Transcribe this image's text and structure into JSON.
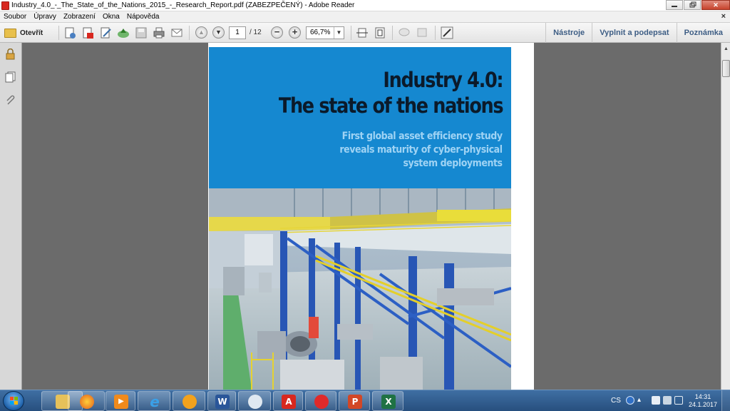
{
  "window": {
    "title": "Industry_4.0_-_The_State_of_the_Nations_2015_-_Research_Report.pdf (ZABEZPEČENÝ) - Adobe Reader",
    "minimize_icon": "minimize-icon",
    "maximize_icon": "restore-icon",
    "close_glyph": "✕"
  },
  "menu": {
    "items": [
      "Soubor",
      "Úpravy",
      "Zobrazení",
      "Okna",
      "Nápověda"
    ],
    "close_glyph": "×"
  },
  "toolbar": {
    "open_label": "Otevřít",
    "current_page": "1",
    "page_count": "/ 12",
    "zoom": "66,7%",
    "zoom_out_glyph": "−",
    "zoom_in_glyph": "+",
    "right_links": [
      "Nástroje",
      "Vyplnit a podepsat",
      "Poznámka"
    ]
  },
  "document": {
    "cover_title_line1": "Industry 4.0:",
    "cover_title_line2": "The state of the nations",
    "cover_subtitle_line1": "First global asset efficiency study",
    "cover_subtitle_line2": "reveals maturity of cyber-physical",
    "cover_subtitle_line3": "system deployments"
  },
  "taskbar": {
    "apps": [
      {
        "name": "explorer",
        "glyph": ""
      },
      {
        "name": "firefox",
        "glyph": ""
      },
      {
        "name": "media-player",
        "glyph": "▶"
      },
      {
        "name": "internet-explorer",
        "glyph": "e"
      },
      {
        "name": "app-orange",
        "glyph": ""
      },
      {
        "name": "word",
        "glyph": "W"
      },
      {
        "name": "mail",
        "glyph": ""
      },
      {
        "name": "adobe-reader",
        "glyph": "A"
      },
      {
        "name": "paint",
        "glyph": ""
      },
      {
        "name": "powerpoint",
        "glyph": "P"
      },
      {
        "name": "excel",
        "glyph": "X"
      }
    ],
    "language": "CS",
    "time": "14:31",
    "date": "24.1.2017"
  },
  "colors": {
    "cover_blue": "#1588d0",
    "link_blue": "#3d5d84",
    "taskbar": "#274f7e"
  }
}
